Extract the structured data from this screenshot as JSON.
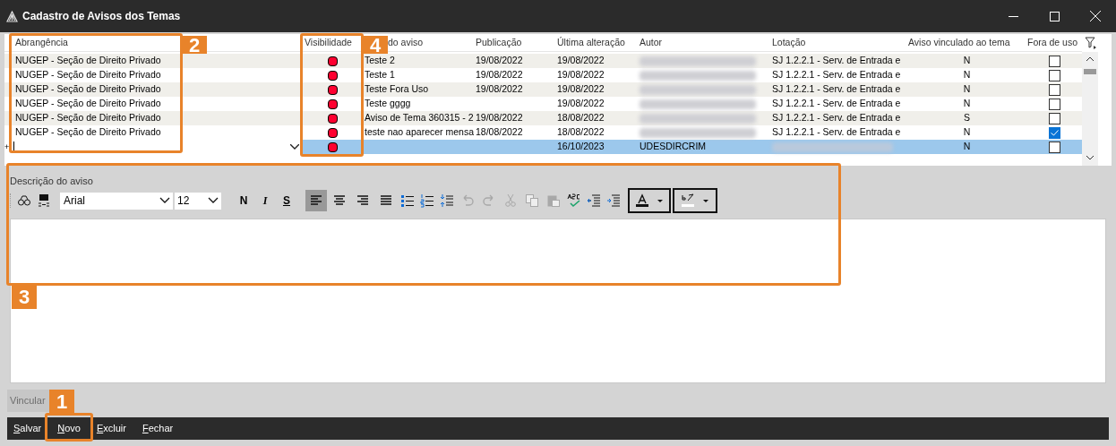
{
  "window": {
    "title": "Cadastro de Avisos dos Temas"
  },
  "grid": {
    "columns": [
      "Abrangência",
      "Visibilidade",
      "do aviso",
      "Publicação",
      "Última alteração",
      "Autor",
      "Lotação",
      "Aviso vinculado ao tema",
      "Fora de uso"
    ],
    "rows": [
      {
        "abrangencia": "NUGEP - Seção de Direito Privado",
        "titulo": "Teste 2",
        "publicacao": "19/08/2022",
        "ultima": "19/08/2022",
        "lotacao": "SJ 1.2.2.1 - Serv. de Entrada e",
        "vinculado": "N",
        "fora_de_uso": false,
        "selected": false
      },
      {
        "abrangencia": "NUGEP - Seção de Direito Privado",
        "titulo": "Teste 1",
        "publicacao": "19/08/2022",
        "ultima": "19/08/2022",
        "lotacao": "SJ 1.2.2.1 - Serv. de Entrada e",
        "vinculado": "N",
        "fora_de_uso": false,
        "selected": false
      },
      {
        "abrangencia": "NUGEP - Seção de Direito Privado",
        "titulo": "Teste Fora Uso",
        "publicacao": "19/08/2022",
        "ultima": "19/08/2022",
        "lotacao": "SJ 1.2.2.1 - Serv. de Entrada e",
        "vinculado": "N",
        "fora_de_uso": false,
        "selected": false
      },
      {
        "abrangencia": "NUGEP - Seção de Direito Privado",
        "titulo": "Teste gggg",
        "ultima": "19/08/2022",
        "lotacao": "SJ 1.2.2.1 - Serv. de Entrada e",
        "vinculado": "N",
        "fora_de_uso": false,
        "selected": false
      },
      {
        "abrangencia": "NUGEP - Seção de Direito Privado",
        "titulo": "Aviso de Tema 360315 - 2",
        "publicacao": "19/08/2022",
        "ultima": "18/08/2022",
        "lotacao": "SJ 1.2.2.1 - Serv. de Entrada e",
        "vinculado": "S",
        "fora_de_uso": false,
        "selected": false
      },
      {
        "abrangencia": "NUGEP - Seção de Direito Privado",
        "titulo": "teste nao aparecer mensa",
        "publicacao": "18/08/2022",
        "ultima": "18/08/2022",
        "lotacao": "SJ 1.2.2.1 - Serv. de Entrada e",
        "vinculado": "N",
        "fora_de_uso": true,
        "selected": false
      },
      {
        "row_marker": "+",
        "ultima": "16/10/2023",
        "autor": "UDESDIRCRIM",
        "vinculado": "N",
        "fora_de_uso": false,
        "selected": true
      }
    ]
  },
  "editor": {
    "label": "Descrição do aviso",
    "font": "Arial",
    "size": "12",
    "bold": "N",
    "italic": "I",
    "underline": "S",
    "align_buttons": [
      {
        "selected": true
      },
      {
        "selected": false
      },
      {
        "selected": false
      },
      {
        "selected": false
      }
    ],
    "edit_buttons": [
      {
        "disabled": true
      },
      {
        "disabled": true
      },
      {
        "disabled": true
      },
      {
        "disabled": true
      },
      {
        "disabled": true
      }
    ]
  },
  "link_button": {
    "label": "Vincular",
    "disabled": true
  },
  "buttons": [
    {
      "label": "Salvar",
      "mnemonic": true
    },
    {
      "label": "Novo",
      "mnemonic": true
    },
    {
      "label": "Excluir",
      "mnemonic": true
    },
    {
      "label": "Fechar",
      "mnemonic": true
    }
  ],
  "callouts": [
    {
      "label": "2"
    },
    {
      "label": "4"
    },
    {
      "label": "3"
    },
    {
      "label": "1"
    }
  ]
}
